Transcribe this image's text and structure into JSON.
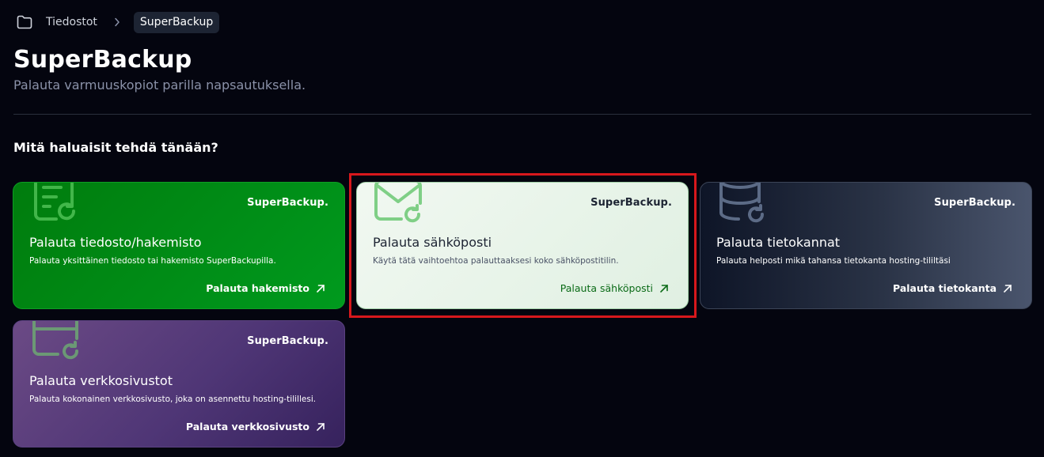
{
  "breadcrumb": {
    "items": [
      {
        "label": "Tiedostot"
      },
      {
        "label": "SuperBackup"
      }
    ]
  },
  "header": {
    "title": "SuperBackup",
    "subtitle": "Palauta varmuuskopiot parilla napsautuksella."
  },
  "section": {
    "heading": "Mitä haluaisit tehdä tänään?"
  },
  "cards": [
    {
      "icon": "file-restore-icon",
      "brand": "SuperBackup.",
      "title": "Palauta tiedosto/hakemisto",
      "description": "Palauta yksittäinen tiedosto tai hakemisto SuperBackupilla.",
      "action": "Palauta hakemisto",
      "accent": "#009a1e"
    },
    {
      "icon": "mail-restore-icon",
      "brand": "SuperBackup.",
      "title": "Palauta sähköposti",
      "description": "Käytä tätä vaihtoehtoa palauttaaksesi koko sähköpostitilin.",
      "action": "Palauta sähköposti",
      "accent": "#e6f3e8"
    },
    {
      "icon": "database-restore-icon",
      "brand": "SuperBackup.",
      "title": "Palauta tietokannat",
      "description": "Palauta helposti mikä tahansa tietokanta hosting-tililtäsi",
      "action": "Palauta tietokanta",
      "accent": "#2a3346"
    },
    {
      "icon": "website-restore-icon",
      "brand": "SuperBackup.",
      "title": "Palauta verkkosivustot",
      "description": "Palauta kokonainen verkkosivusto, joka on asennettu hosting-tilillesi.",
      "action": "Palauta verkkosivusto",
      "accent": "#4f3676"
    }
  ],
  "colors": {
    "background": "#04050f",
    "highlight": "#d8181c"
  }
}
